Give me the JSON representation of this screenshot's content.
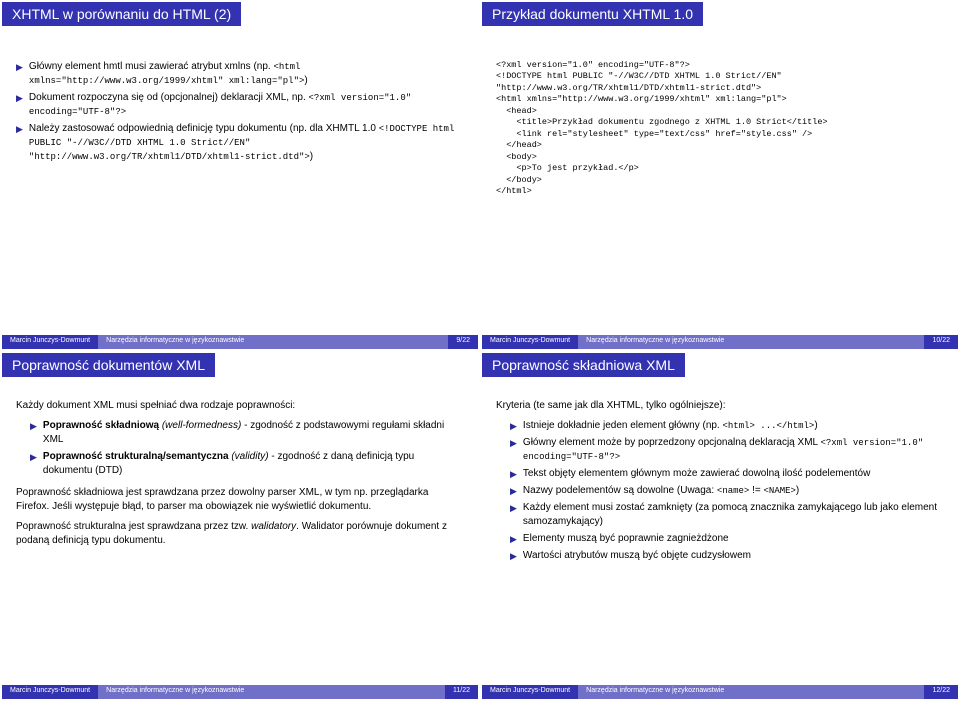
{
  "slides": [
    {
      "title": "XHTML w porównaniu do HTML (2)",
      "bullets": [
        {
          "text": "Główny element hmtl musi zawierać atrybut xmlns (np. ",
          "code": "<html xmlns=\"http://www.w3.org/1999/xhtml\" xml:lang=\"pl\">",
          "after": ")"
        },
        {
          "text": "Dokument rozpoczyna się od (opcjonalnej) deklaracji XML, np. ",
          "code": "<?xml version=\"1.0\" encoding=\"UTF-8\"?>",
          "after": ""
        },
        {
          "text": "Należy zastosować odpowiednią definicję typu dokumentu (np. dla XHMTL 1.0 ",
          "code": "<!DOCTYPE html PUBLIC \"-//W3C//DTD XHTML 1.0 Strict//EN\" \"http://www.w3.org/TR/xhtml1/DTD/xhtml1-strict.dtd\">",
          "after": ")"
        }
      ],
      "footer": {
        "author": "Marcin Junczys-Dowmunt",
        "mid": "Narzędzia informatyczne w językoznawstwie",
        "page": "9/22"
      }
    },
    {
      "title": "Przykład dokumentu XHTML 1.0",
      "code": "<?xml version=\"1.0\" encoding=\"UTF-8\"?>\n<!DOCTYPE html PUBLIC \"-//W3C//DTD XHTML 1.0 Strict//EN\"\n\"http://www.w3.org/TR/xhtml1/DTD/xhtml1-strict.dtd\">\n<html xmlns=\"http://www.w3.org/1999/xhtml\" xml:lang=\"pl\">\n  <head>\n    <title>Przykład dokumentu zgodnego z XHTML 1.0 Strict</title>\n    <link rel=\"stylesheet\" type=\"text/css\" href=\"style.css\" />\n  </head>\n  <body>\n    <p>To jest przykład.</p>\n  </body>\n</html>",
      "footer": {
        "author": "Marcin Junczys-Dowmunt",
        "mid": "Narzędzia informatyczne w językoznawstwie",
        "page": "10/22"
      }
    },
    {
      "title": "Poprawność dokumentów XML",
      "intro": "Każdy dokument XML musi spełniać dwa rodzaje poprawności:",
      "bullets": [
        {
          "bold": "Poprawność składniową",
          "italic": " (well-formedness)",
          "text": " - zgodność z podstawowymi regułami składni XML"
        },
        {
          "bold": "Poprawność strukturalną/semantyczna",
          "italic": " (validity)",
          "text": " - zgodność z daną definicją typu dokumentu (DTD)"
        }
      ],
      "paras": [
        "Poprawność składniowa jest sprawdzana przez dowolny parser XML, w tym np. przeglądarka Firefox. Jeśli występuje błąd, to parser ma obowiązek nie wyświetlić dokumentu.",
        "Poprawność strukturalna jest sprawdzana przez tzw. walidatory. Walidator porównuje dokument z podaną definicją typu dokumentu."
      ],
      "footer": {
        "author": "Marcin Junczys-Dowmunt",
        "mid": "Narzędzia informatyczne w językoznawstwie",
        "page": "11/22"
      }
    },
    {
      "title": "Poprawność składniowa XML",
      "intro": "Kryteria (te same jak dla XHTML, tylko ogólniejsze):",
      "bullets": [
        {
          "text": "Istnieje dokładnie jeden element główny (np. ",
          "code": "<html> ...</html>",
          "after": ")"
        },
        {
          "text": "Główny element może by poprzedzony opcjonalną deklaracją XML ",
          "code": "<?xml version=\"1.0\" encoding=\"UTF-8\"?>",
          "after": ""
        },
        {
          "text": "Tekst objęty elementem głównym może zawierać dowolną ilość podelementów"
        },
        {
          "text": "Nazwy podelementów są dowolne (Uwaga: ",
          "code": "<name>",
          "mid": " != ",
          "code2": "<NAME>",
          "after": ")"
        },
        {
          "text": "Każdy element musi zostać zamknięty (za pomocą znacznika zamykającego lub jako element samozamykający)"
        },
        {
          "text": "Elementy muszą być poprawnie zagnieżdżone"
        },
        {
          "text": "Wartości atrybutów muszą być objęte cudzysłowem"
        }
      ],
      "footer": {
        "author": "Marcin Junczys-Dowmunt",
        "mid": "Narzędzia informatyczne w językoznawstwie",
        "page": "12/22"
      }
    }
  ]
}
